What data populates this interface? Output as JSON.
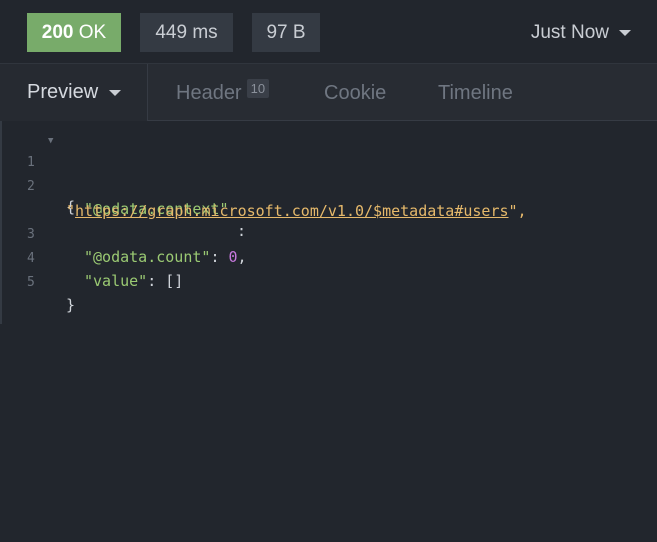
{
  "status": {
    "code": "200",
    "text": "OK",
    "time": "449 ms",
    "size": "97 B",
    "timestamp": "Just Now"
  },
  "colors": {
    "status_ok": "#78ab6a",
    "background": "#22262d",
    "json_key": "#9bca73",
    "json_string": "#e6b96b",
    "json_number": "#c678dd"
  },
  "tabs": {
    "preview": "Preview",
    "header": "Header",
    "header_count": "10",
    "cookie": "Cookie",
    "timeline": "Timeline"
  },
  "code": {
    "line_numbers": [
      "1",
      "2",
      "3",
      "4",
      "5"
    ],
    "open_brace": "{",
    "close_brace": "}",
    "context_key": "\"@odata.context\"",
    "colon": ":",
    "quote_open": "\"",
    "context_url": "https://graph.microsoft.com/v1.0/$metadata#users",
    "quote_close_comma": "\",",
    "count_key": "\"@odata.count\"",
    "colon_space": ": ",
    "count_value": "0",
    "comma": ",",
    "value_key": "\"value\"",
    "value_value": "[]"
  }
}
